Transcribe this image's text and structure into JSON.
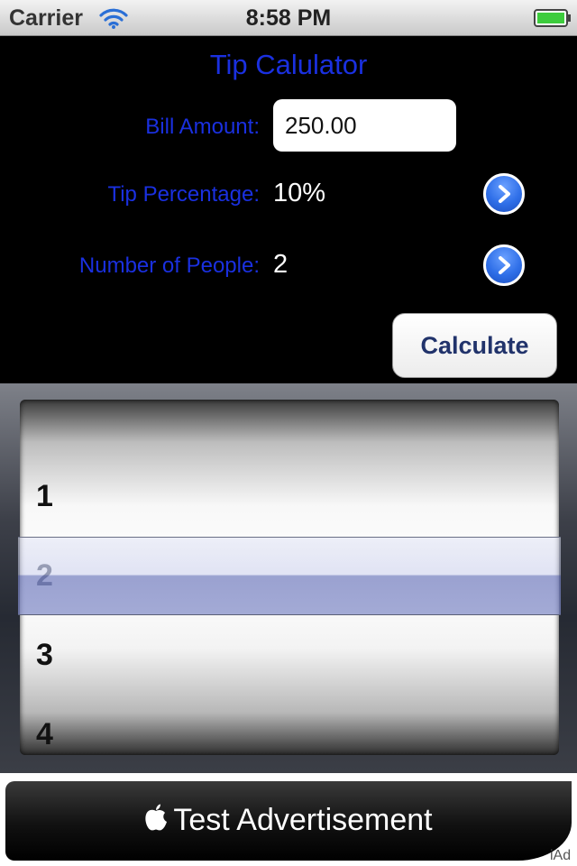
{
  "status_bar": {
    "carrier": "Carrier",
    "time": "8:58 PM",
    "wifi_icon": "wifi-icon",
    "battery_icon": "battery-full-icon"
  },
  "app": {
    "title": "Tip Calulator"
  },
  "form": {
    "bill_label": "Bill Amount:",
    "bill_value": "250.00",
    "tip_label": "Tip Percentage:",
    "tip_value": "10%",
    "people_label": "Number of People:",
    "people_value": "2",
    "calculate_label": "Calculate"
  },
  "picker": {
    "rows": [
      "1",
      "2",
      "3",
      "4"
    ],
    "selected": "2"
  },
  "ad": {
    "text": "Test Advertisement",
    "badge": "iAd"
  },
  "colors": {
    "label_blue": "#1a30e0",
    "button_text": "#21336b",
    "disclosure_blue": "#2f6fe8"
  }
}
